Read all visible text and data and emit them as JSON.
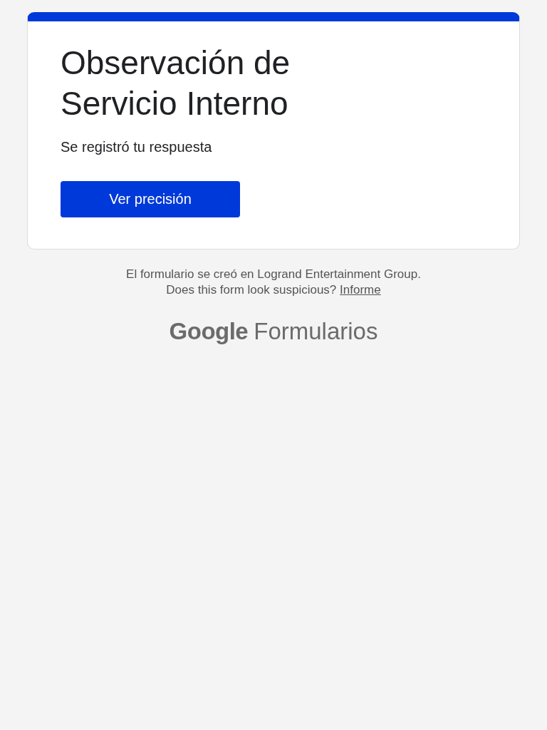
{
  "form": {
    "title": "Observación de Servicio Interno",
    "message": "Se registró tu respuesta",
    "button": "Ver precisión"
  },
  "footer": {
    "created_by": "El formulario se creó en Logrand Entertainment Group.",
    "question": "Does this form look suspicious?",
    "link": "Informe"
  },
  "brand": {
    "company": "Google",
    "product": "Formularios"
  }
}
